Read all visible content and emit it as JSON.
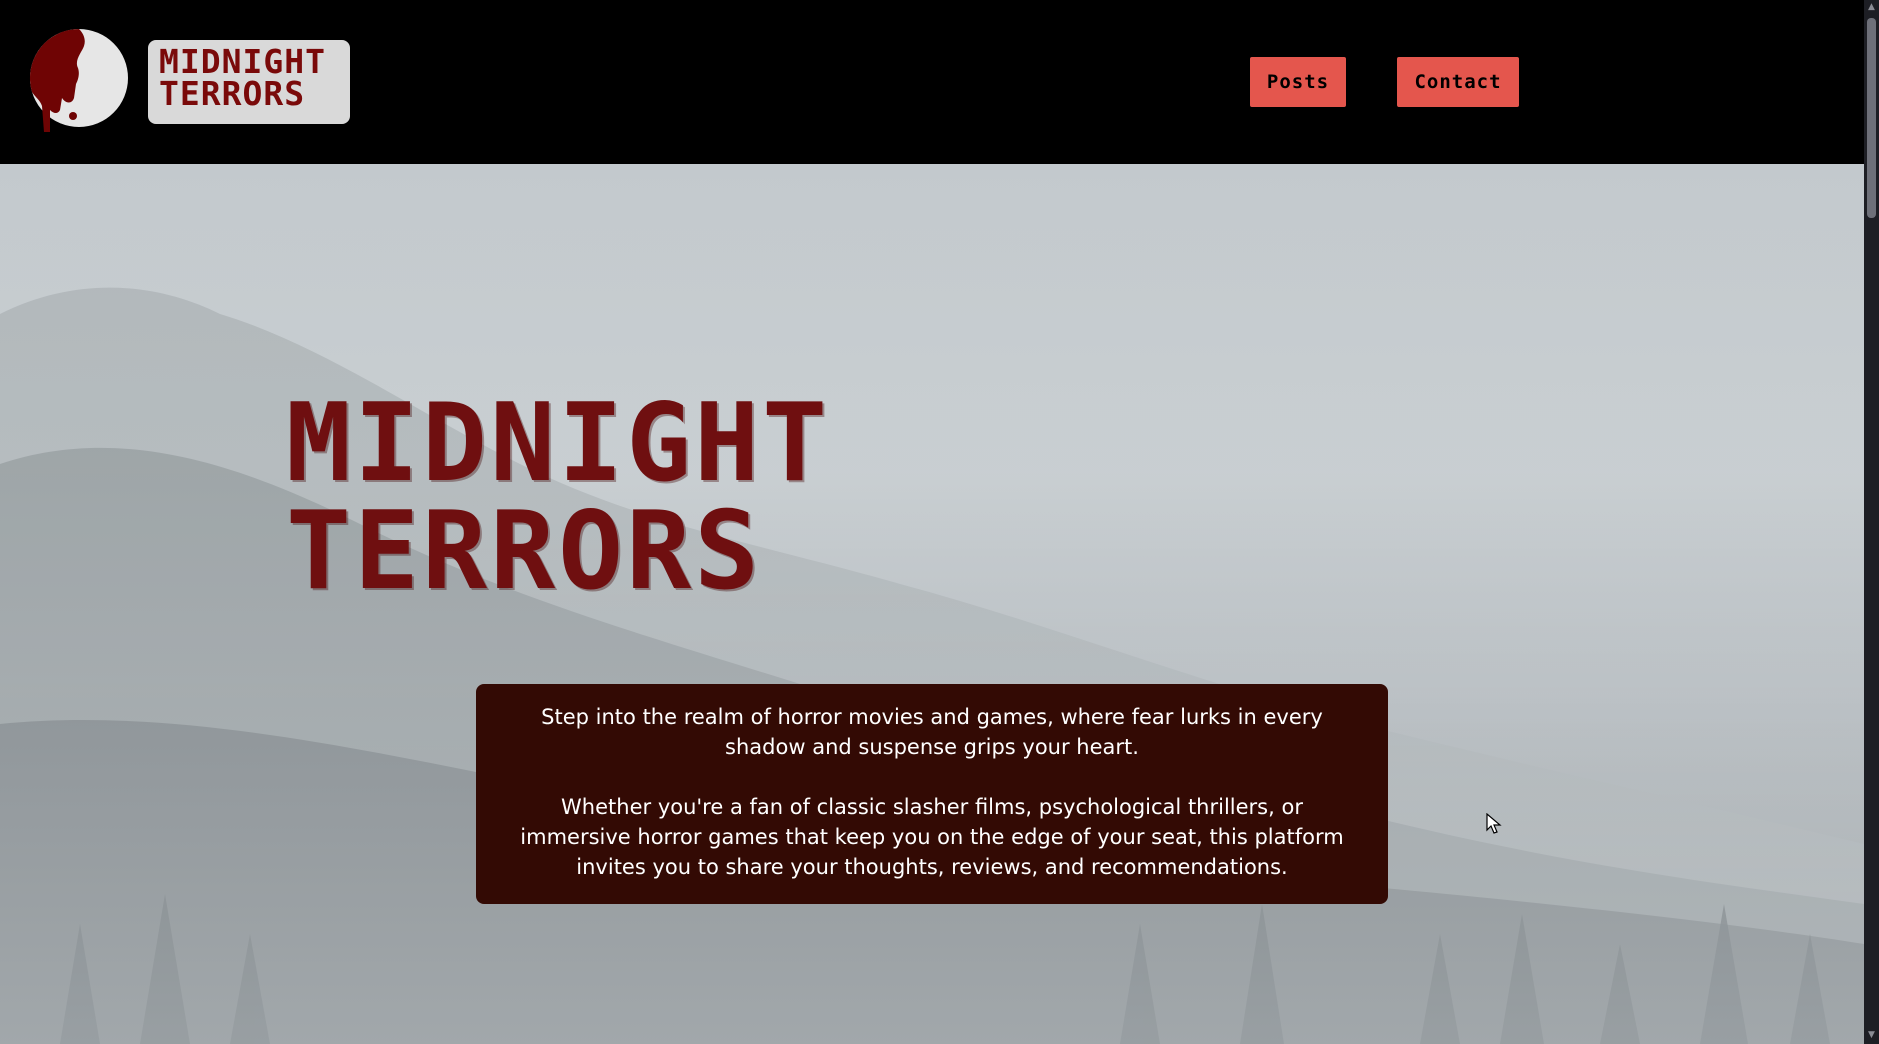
{
  "header": {
    "logo": {
      "icon": "blood-drip-moon-icon",
      "text_line1": "MIDNIGHT",
      "text_line2": "TERRORS"
    },
    "nav": {
      "posts_label": "Posts",
      "contact_label": "Contact"
    }
  },
  "hero": {
    "title_line1": "MIDNIGHT",
    "title_line2": "TERRORS",
    "intro_paragraph1": "Step into the realm of horror movies and games, where fear lurks in every shadow and suspense grips your heart.",
    "intro_paragraph2": "Whether you're a fan of classic slasher films, psychological thrillers, or immersive horror games that keep you on the edge of your seat, this platform invites you to share your thoughts, reviews, and recommendations."
  },
  "colors": {
    "header_bg": "#000000",
    "brand_red": "#6f0f10",
    "button_bg": "#e4564d",
    "intro_box_bg": "#330a04",
    "logo_box_bg": "#d9d9d9"
  },
  "icons": {
    "cursor": "mouse-pointer-icon",
    "scroll_up": "scroll-up-arrow-icon",
    "scroll_down": "scroll-down-arrow-icon"
  }
}
